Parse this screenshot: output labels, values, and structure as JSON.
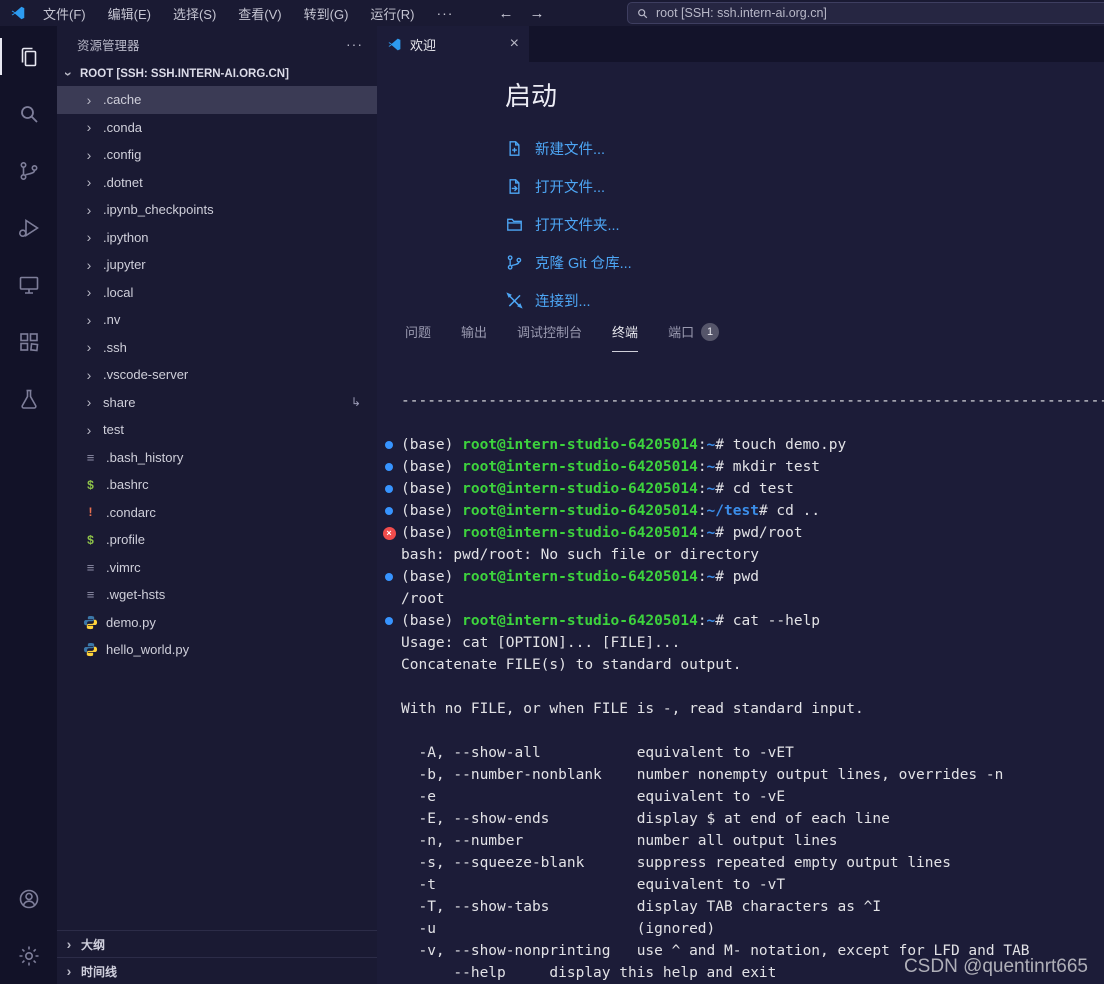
{
  "titlebar": {
    "menus": [
      "文件(F)",
      "编辑(E)",
      "选择(S)",
      "查看(V)",
      "转到(G)",
      "运行(R)"
    ],
    "overflow_label": "···",
    "search_label": "root [SSH: ssh.intern-ai.org.cn]"
  },
  "activity_bar": {
    "items": [
      {
        "name": "explorer",
        "active": true
      },
      {
        "name": "search"
      },
      {
        "name": "source-control"
      },
      {
        "name": "run-debug"
      },
      {
        "name": "remote-explorer"
      },
      {
        "name": "extensions"
      },
      {
        "name": "testing"
      }
    ],
    "bottom_items": [
      {
        "name": "account"
      },
      {
        "name": "settings"
      }
    ]
  },
  "sidebar": {
    "title": "资源管理器",
    "section": "ROOT [SSH: SSH.INTERN-AI.ORG.CN]",
    "items": [
      {
        "label": ".cache",
        "kind": "folder",
        "selected": true
      },
      {
        "label": ".conda",
        "kind": "folder"
      },
      {
        "label": ".config",
        "kind": "folder"
      },
      {
        "label": ".dotnet",
        "kind": "folder"
      },
      {
        "label": ".ipynb_checkpoints",
        "kind": "folder"
      },
      {
        "label": ".ipython",
        "kind": "folder"
      },
      {
        "label": ".jupyter",
        "kind": "folder"
      },
      {
        "label": ".local",
        "kind": "folder"
      },
      {
        "label": ".nv",
        "kind": "folder"
      },
      {
        "label": ".ssh",
        "kind": "folder"
      },
      {
        "label": ".vscode-server",
        "kind": "folder"
      },
      {
        "label": "share",
        "kind": "folder",
        "symlink": true
      },
      {
        "label": "test",
        "kind": "folder"
      },
      {
        "label": ".bash_history",
        "kind": "file",
        "icon": "list-file-icon"
      },
      {
        "label": ".bashrc",
        "kind": "file",
        "icon": "shell-file-icon"
      },
      {
        "label": ".condarc",
        "kind": "file",
        "icon": "config-warning-icon"
      },
      {
        "label": ".profile",
        "kind": "file",
        "icon": "shell-file-icon"
      },
      {
        "label": ".vimrc",
        "kind": "file",
        "icon": "list-file-icon"
      },
      {
        "label": ".wget-hsts",
        "kind": "file",
        "icon": "list-file-icon"
      },
      {
        "label": "demo.py",
        "kind": "file",
        "icon": "python-file-icon"
      },
      {
        "label": "hello_world.py",
        "kind": "file",
        "icon": "python-file-icon"
      }
    ],
    "bottom_sections": [
      "大纲",
      "时间线"
    ]
  },
  "editor": {
    "tab_label": "欢迎",
    "welcome_title": "启动",
    "links": [
      {
        "label": "新建文件...",
        "icon": "new-file-icon"
      },
      {
        "label": "打开文件...",
        "icon": "open-file-icon"
      },
      {
        "label": "打开文件夹...",
        "icon": "open-folder-icon"
      },
      {
        "label": "克隆 Git 仓库...",
        "icon": "git-clone-icon"
      },
      {
        "label": "连接到...",
        "icon": "remote-connect-icon"
      }
    ]
  },
  "panel": {
    "tabs": [
      {
        "label": "问题"
      },
      {
        "label": "输出"
      },
      {
        "label": "调试控制台"
      },
      {
        "label": "终端",
        "active": true
      },
      {
        "label": "端口",
        "badge": "1"
      }
    ],
    "terminal_lines": [
      {
        "text": "--------------------------------------------------------------------------------------------------------------"
      },
      {
        "text": ""
      },
      {
        "marker": "dot",
        "seg": [
          [
            "t",
            "(base) "
          ],
          [
            "user",
            "root@intern-studio-64205014"
          ],
          [
            "t",
            ":"
          ],
          [
            "path",
            "~"
          ],
          [
            "t",
            "# touch demo.py"
          ]
        ]
      },
      {
        "marker": "dot",
        "seg": [
          [
            "t",
            "(base) "
          ],
          [
            "user",
            "root@intern-studio-64205014"
          ],
          [
            "t",
            ":"
          ],
          [
            "path",
            "~"
          ],
          [
            "t",
            "# mkdir test"
          ]
        ]
      },
      {
        "marker": "dot",
        "seg": [
          [
            "t",
            "(base) "
          ],
          [
            "user",
            "root@intern-studio-64205014"
          ],
          [
            "t",
            ":"
          ],
          [
            "path",
            "~"
          ],
          [
            "t",
            "# cd test"
          ]
        ]
      },
      {
        "marker": "dot",
        "seg": [
          [
            "t",
            "(base) "
          ],
          [
            "user",
            "root@intern-studio-64205014"
          ],
          [
            "t",
            ":"
          ],
          [
            "path",
            "~/test"
          ],
          [
            "t",
            "# cd .."
          ]
        ]
      },
      {
        "marker": "err",
        "seg": [
          [
            "t",
            "(base) "
          ],
          [
            "user",
            "root@intern-studio-64205014"
          ],
          [
            "t",
            ":"
          ],
          [
            "path",
            "~"
          ],
          [
            "t",
            "# pwd/root"
          ]
        ]
      },
      {
        "text": "bash: pwd/root: No such file or directory"
      },
      {
        "marker": "dot",
        "seg": [
          [
            "t",
            "(base) "
          ],
          [
            "user",
            "root@intern-studio-64205014"
          ],
          [
            "t",
            ":"
          ],
          [
            "path",
            "~"
          ],
          [
            "t",
            "# pwd"
          ]
        ]
      },
      {
        "text": "/root"
      },
      {
        "marker": "dot",
        "seg": [
          [
            "t",
            "(base) "
          ],
          [
            "user",
            "root@intern-studio-64205014"
          ],
          [
            "t",
            ":"
          ],
          [
            "path",
            "~"
          ],
          [
            "t",
            "# cat --help"
          ]
        ]
      },
      {
        "text": "Usage: cat [OPTION]... [FILE]..."
      },
      {
        "text": "Concatenate FILE(s) to standard output."
      },
      {
        "text": ""
      },
      {
        "text": "With no FILE, or when FILE is -, read standard input."
      },
      {
        "text": ""
      },
      {
        "text": "  -A, --show-all           equivalent to -vET"
      },
      {
        "text": "  -b, --number-nonblank    number nonempty output lines, overrides -n"
      },
      {
        "text": "  -e                       equivalent to -vE"
      },
      {
        "text": "  -E, --show-ends          display $ at end of each line"
      },
      {
        "text": "  -n, --number             number all output lines"
      },
      {
        "text": "  -s, --squeeze-blank      suppress repeated empty output lines"
      },
      {
        "text": "  -t                       equivalent to -vT"
      },
      {
        "text": "  -T, --show-tabs          display TAB characters as ^I"
      },
      {
        "text": "  -u                       (ignored)"
      },
      {
        "text": "  -v, --show-nonprinting   use ^ and M- notation, except for LFD and TAB"
      },
      {
        "text": "      --help     display this help and exit"
      }
    ]
  },
  "watermark": "CSDN @quentinrt665"
}
